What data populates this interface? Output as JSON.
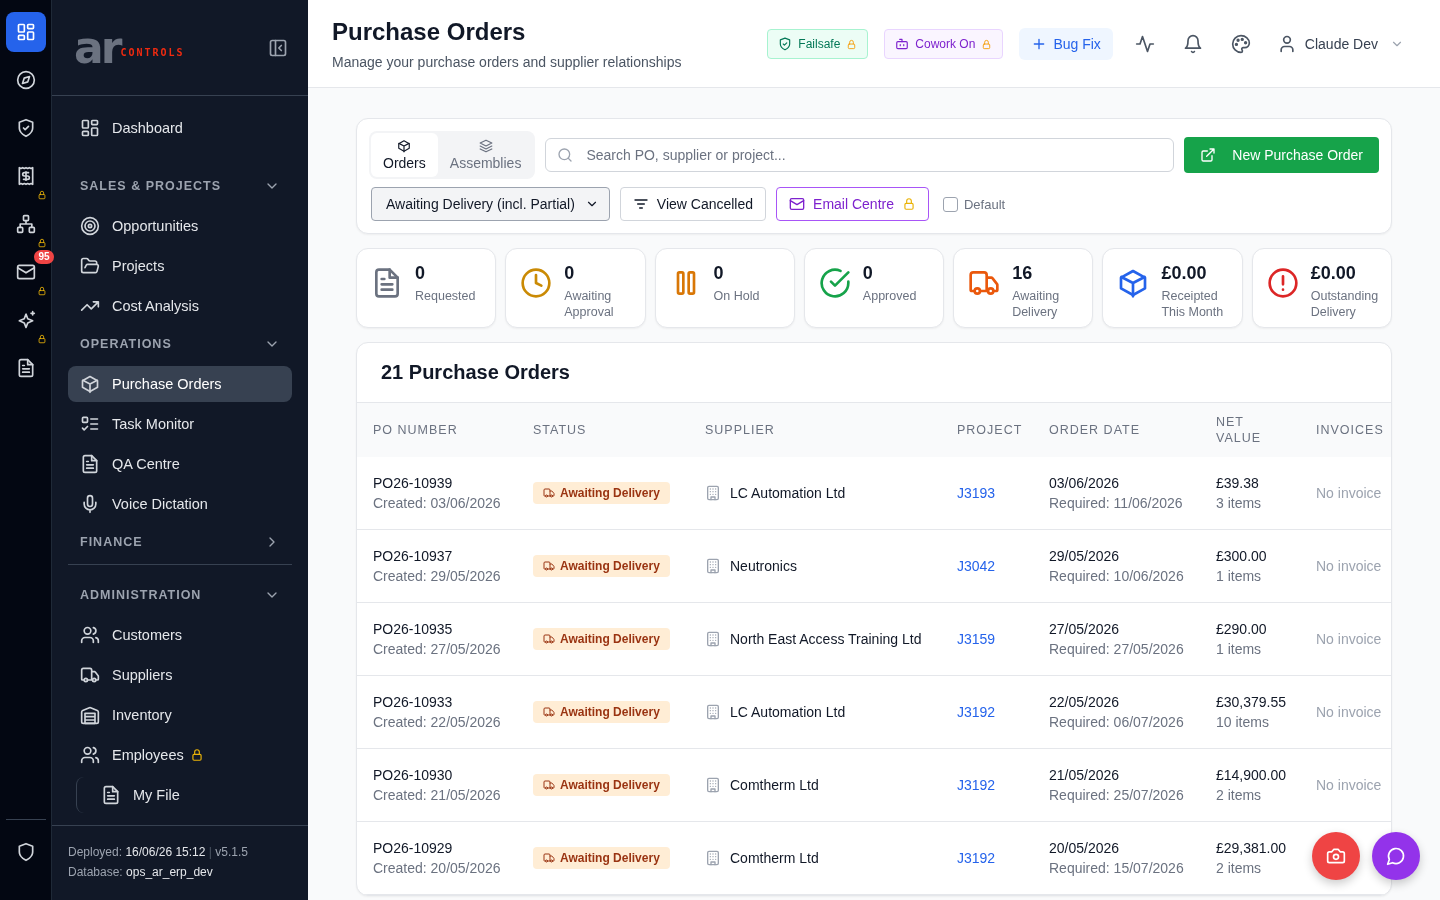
{
  "rail": {
    "items": [
      {
        "selected": true,
        "locked": false
      },
      {
        "selected": false,
        "locked": false
      },
      {
        "selected": false,
        "locked": false
      },
      {
        "selected": false,
        "locked": true
      },
      {
        "selected": false,
        "locked": true
      },
      {
        "selected": false,
        "locked": true,
        "badge": "95"
      },
      {
        "selected": false,
        "locked": true
      },
      {
        "selected": false,
        "locked": false
      }
    ]
  },
  "sidebar": {
    "logo": {
      "mark": "ar",
      "word": "CONTROLS"
    },
    "top_items": [
      {
        "label": "Dashboard",
        "selected": false
      }
    ],
    "sections": [
      {
        "title": "SALES & PROJECTS",
        "expanded": true,
        "items": [
          {
            "label": "Opportunities",
            "selected": false,
            "locked": false
          },
          {
            "label": "Projects",
            "selected": false,
            "locked": false
          },
          {
            "label": "Cost Analysis",
            "selected": false,
            "locked": false
          }
        ]
      },
      {
        "title": "OPERATIONS",
        "expanded": true,
        "items": [
          {
            "label": "Purchase Orders",
            "selected": true,
            "locked": false
          },
          {
            "label": "Task Monitor",
            "selected": false,
            "locked": false
          },
          {
            "label": "QA Centre",
            "selected": false,
            "locked": false
          },
          {
            "label": "Voice Dictation",
            "selected": false,
            "locked": false
          }
        ]
      },
      {
        "title": "FINANCE",
        "expanded": false
      },
      {
        "title": "ADMINISTRATION",
        "expanded": true,
        "items": [
          {
            "label": "Customers",
            "selected": false,
            "locked": false
          },
          {
            "label": "Suppliers",
            "selected": false,
            "locked": false
          },
          {
            "label": "Inventory",
            "selected": false,
            "locked": false
          },
          {
            "label": "Employees",
            "selected": false,
            "locked": true,
            "children": [
              {
                "label": "My File",
                "selected": false,
                "locked": false
              }
            ]
          }
        ]
      }
    ],
    "footer": {
      "deployed_label": "Deployed:",
      "deployed": "16/06/26 15:12",
      "separator": "|",
      "version": "v5.1.5",
      "database_label": "Database:",
      "database": "ops_ar_erp_dev"
    }
  },
  "header": {
    "title": "Purchase Orders",
    "subtitle": "Manage your purchase orders and supplier relationships",
    "badges": [
      {
        "label": "Failsafe",
        "color": "#047857",
        "locked": true
      },
      {
        "label": "Cowork On",
        "color": "#7e22ce",
        "locked": true
      }
    ],
    "bug_fix": "Bug Fix",
    "user": "Claude Dev"
  },
  "toolbar": {
    "view_tabs": [
      {
        "label": "Orders",
        "selected": true
      },
      {
        "label": "Assemblies",
        "selected": false
      }
    ],
    "search": {
      "placeholder": "Search PO, supplier or project..."
    },
    "status_filter": {
      "value": "Awaiting Delivery (incl. Partial)"
    },
    "view_cancelled": {
      "label": "View Cancelled"
    },
    "email_centre": {
      "label": "Email Centre",
      "locked": true
    },
    "default_toggle": {
      "label": "Default",
      "checked": false
    },
    "new_button": "New Purchase Order"
  },
  "stats": [
    {
      "value": "0",
      "label": "Requested",
      "color": "#6b7280"
    },
    {
      "value": "0",
      "label": "Awaiting Approval",
      "color": "#ca8a04"
    },
    {
      "value": "0",
      "label": "On Hold",
      "color": "#d97706"
    },
    {
      "value": "0",
      "label": "Approved",
      "color": "#16a34a"
    },
    {
      "value": "16",
      "label": "Awaiting Delivery",
      "color": "#ea580c"
    },
    {
      "value": "£0.00",
      "label": "Receipted This Month",
      "color": "#2563eb"
    },
    {
      "value": "£0.00",
      "label": "Outstanding Delivery",
      "color": "#dc2626"
    }
  ],
  "table": {
    "title": "21 Purchase Orders",
    "columns": [
      "PO NUMBER",
      "STATUS",
      "SUPPLIER",
      "PROJECT",
      "ORDER DATE",
      "NET VALUE",
      "INVOICES"
    ],
    "rows": [
      {
        "po": "PO26-10939",
        "created": "Created: 03/06/2026",
        "status": "Awaiting Delivery",
        "supplier": "LC Automation Ltd",
        "project": "J3193",
        "order_date": "03/06/2026",
        "required": "Required: 11/06/2026",
        "net_value": "£39.38",
        "items": "3 items",
        "invoices": "No invoice"
      },
      {
        "po": "PO26-10937",
        "created": "Created: 29/05/2026",
        "status": "Awaiting Delivery",
        "supplier": "Neutronics",
        "project": "J3042",
        "order_date": "29/05/2026",
        "required": "Required: 10/06/2026",
        "net_value": "£300.00",
        "items": "1 items",
        "invoices": "No invoice"
      },
      {
        "po": "PO26-10935",
        "created": "Created: 27/05/2026",
        "status": "Awaiting Delivery",
        "supplier": "North East Access Training Ltd",
        "project": "J3159",
        "order_date": "27/05/2026",
        "required": "Required: 27/05/2026",
        "net_value": "£290.00",
        "items": "1 items",
        "invoices": "No invoice"
      },
      {
        "po": "PO26-10933",
        "created": "Created: 22/05/2026",
        "status": "Awaiting Delivery",
        "supplier": "LC Automation Ltd",
        "project": "J3192",
        "order_date": "22/05/2026",
        "required": "Required: 06/07/2026",
        "net_value": "£30,379.55",
        "items": "10 items",
        "invoices": "No invoice"
      },
      {
        "po": "PO26-10930",
        "created": "Created: 21/05/2026",
        "status": "Awaiting Delivery",
        "supplier": "Comtherm Ltd",
        "project": "J3192",
        "order_date": "21/05/2026",
        "required": "Required: 25/07/2026",
        "net_value": "£14,900.00",
        "items": "2 items",
        "invoices": "No invoice"
      },
      {
        "po": "PO26-10929",
        "created": "Created: 20/05/2026",
        "status": "Awaiting Delivery",
        "supplier": "Comtherm Ltd",
        "project": "J3192",
        "order_date": "20/05/2026",
        "required": "Required: 15/07/2026",
        "net_value": "£29,381.00",
        "items": "2 items"
      }
    ]
  }
}
